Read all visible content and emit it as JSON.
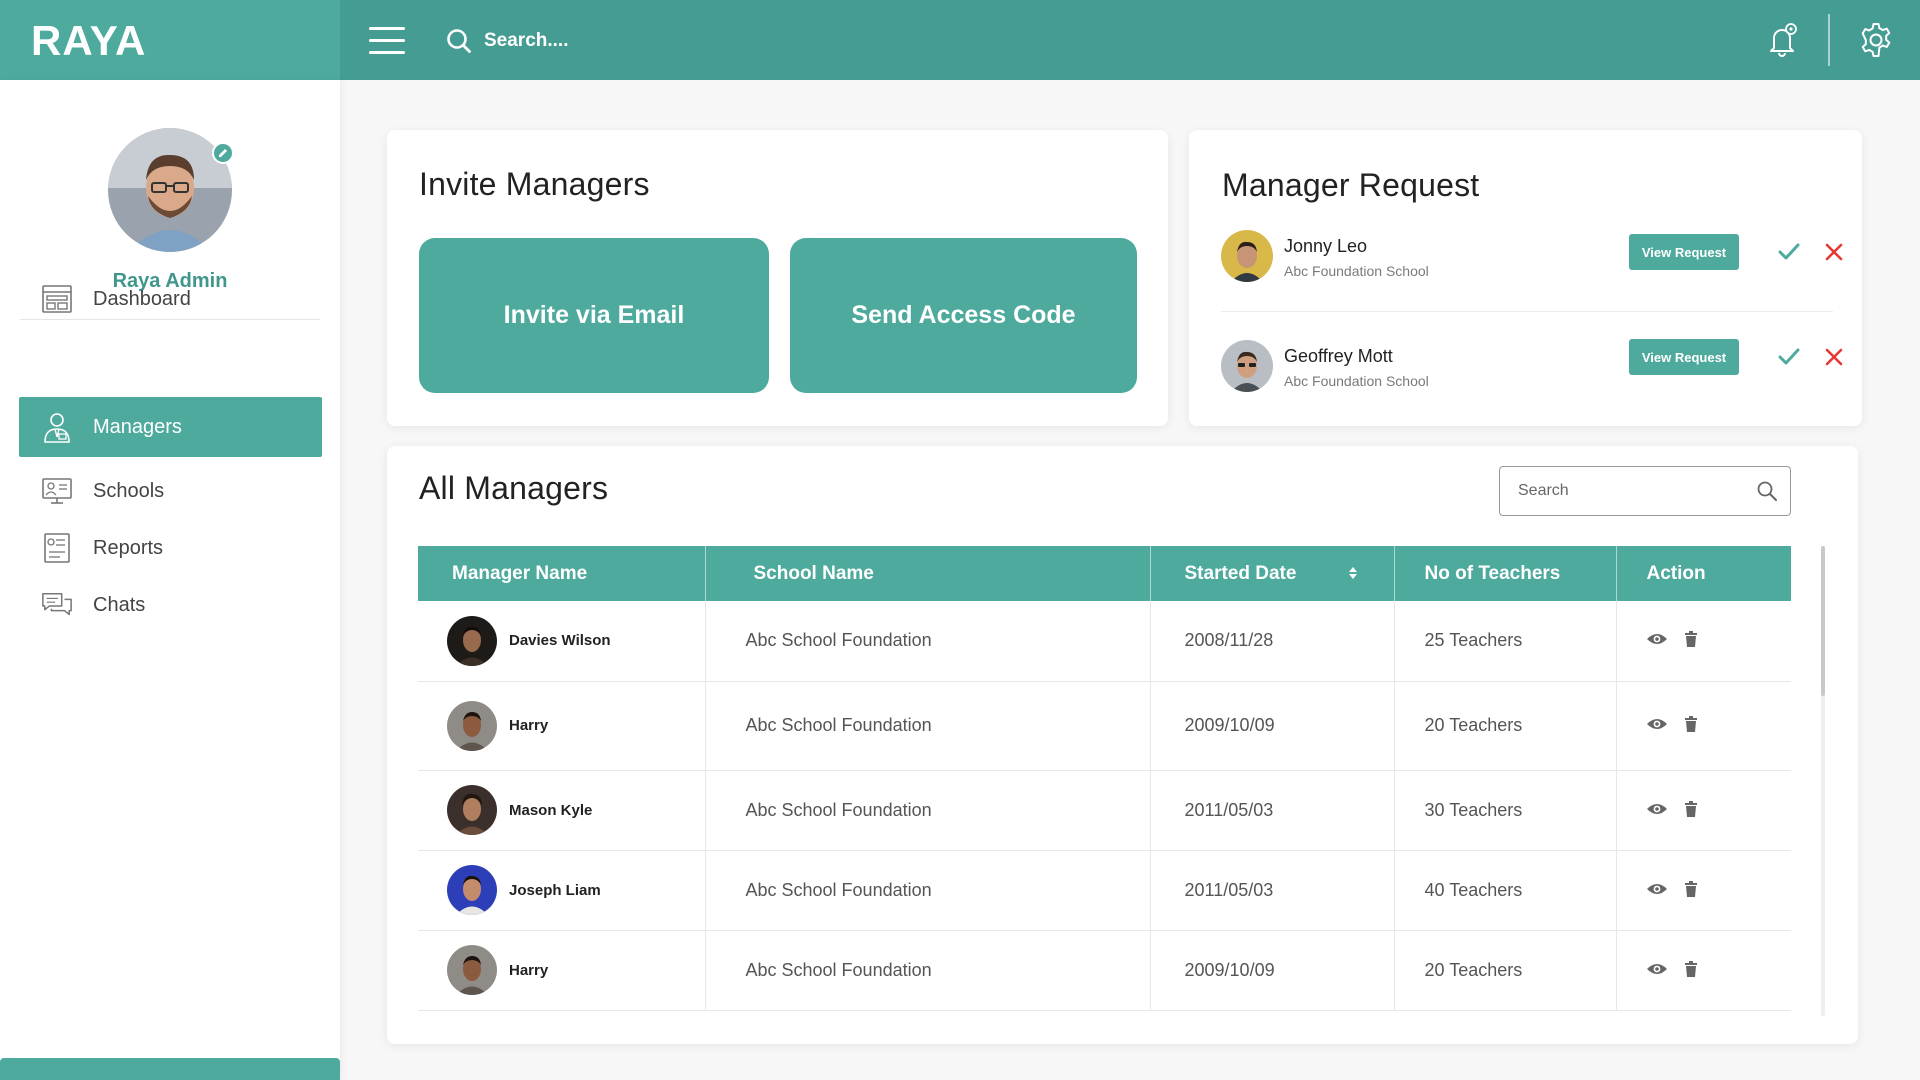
{
  "app": {
    "brand": "RAYA"
  },
  "topbar": {
    "search_placeholder": "Search...."
  },
  "user": {
    "name": "Raya Admin"
  },
  "sidebar": {
    "items": [
      {
        "label": "Dashboard",
        "icon": "dashboard-icon",
        "active": false
      },
      {
        "label": "Managers",
        "icon": "manager-icon",
        "active": true
      },
      {
        "label": "Schools",
        "icon": "school-icon",
        "active": false
      },
      {
        "label": "Reports",
        "icon": "report-icon",
        "active": false
      },
      {
        "label": "Chats",
        "icon": "chat-icon",
        "active": false
      }
    ]
  },
  "invite": {
    "title": "Invite Managers",
    "email_label": "Invite via Email",
    "code_label": "Send Access Code"
  },
  "requests": {
    "title": "Manager Request",
    "view_label": "View Request",
    "items": [
      {
        "name": "Jonny Leo",
        "school": "Abc Foundation School"
      },
      {
        "name": "Geoffrey Mott",
        "school": "Abc Foundation School"
      }
    ]
  },
  "managers": {
    "title": "All Managers",
    "search_placeholder": "Search",
    "columns": [
      "Manager Name",
      "School Name",
      "Started Date",
      "No of Teachers",
      "Action"
    ],
    "rows": [
      {
        "name": "Davies Wilson",
        "school": "Abc School Foundation",
        "date": "2008/11/28",
        "teachers": "25 Teachers"
      },
      {
        "name": "Harry",
        "school": "Abc School Foundation",
        "date": "2009/10/09",
        "teachers": "20 Teachers"
      },
      {
        "name": "Mason Kyle",
        "school": "Abc School Foundation",
        "date": "2011/05/03",
        "teachers": "30 Teachers"
      },
      {
        "name": "Joseph Liam",
        "school": "Abc School Foundation",
        "date": "2011/05/03",
        "teachers": "40 Teachers"
      },
      {
        "name": "Harry",
        "school": "Abc School Foundation",
        "date": "2009/10/09",
        "teachers": "20 Teachers"
      }
    ]
  },
  "colors": {
    "primary": "#4daa9d",
    "topbar": "#459c92",
    "accent_text": "#3f978c",
    "reject": "#e53935"
  }
}
